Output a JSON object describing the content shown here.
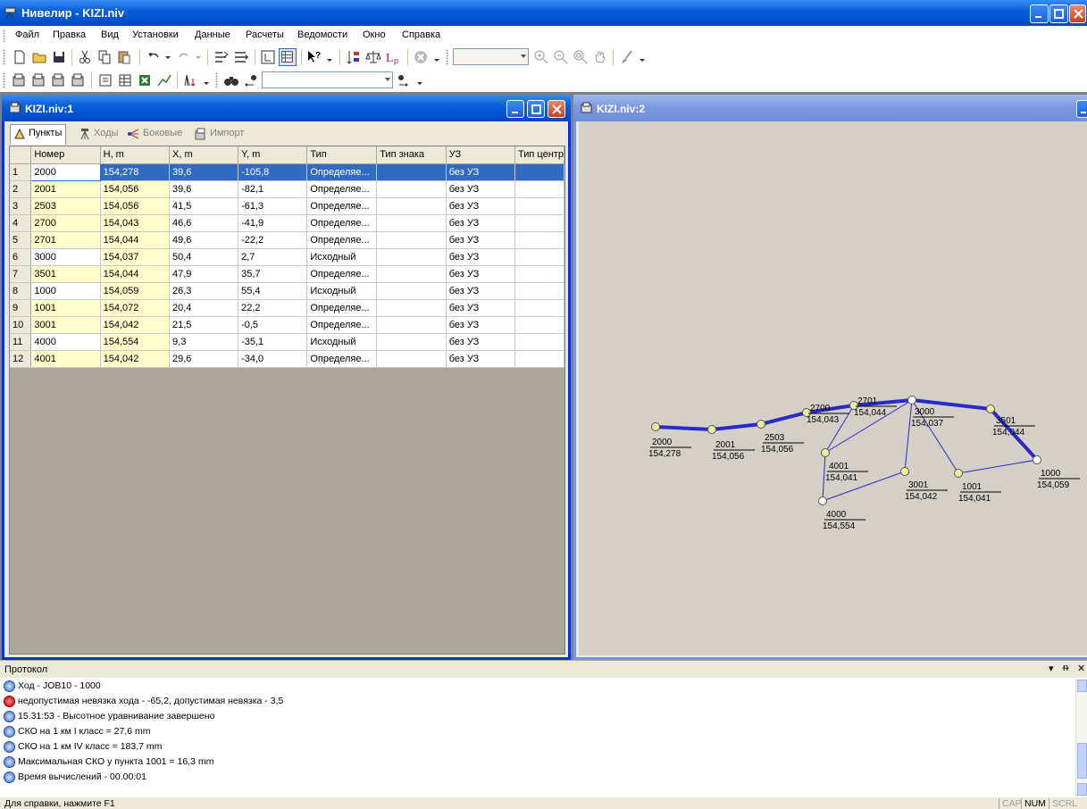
{
  "app": {
    "title": "Нивелир - KIZI.niv"
  },
  "menu": [
    "Файл",
    "Правка",
    "Вид",
    "Установки",
    "Данные",
    "Расчеты",
    "Ведомости",
    "Окно",
    "Справка"
  ],
  "windows": {
    "table_title": "KIZI.niv:1",
    "map_title": "KIZI.niv:2"
  },
  "tabs": [
    {
      "label": "Пункты",
      "active": true,
      "icon": "survey-point-icon"
    },
    {
      "label": "Ходы",
      "active": false,
      "icon": "tripod-icon"
    },
    {
      "label": "Боковые",
      "active": false,
      "icon": "branch-icon"
    },
    {
      "label": "Импорт",
      "active": false,
      "icon": "import-icon"
    }
  ],
  "table": {
    "columns": [
      "Номер",
      "H, m",
      "X, m",
      "Y, m",
      "Тип",
      "Тип знака",
      "УЗ",
      "Тип центр"
    ],
    "rows": [
      {
        "n": "1",
        "num": "2000",
        "h": "154,278",
        "x": "39,6",
        "y": "-105,8",
        "type": "Определяе...",
        "sign": "",
        "uz": "без УЗ",
        "center": ""
      },
      {
        "n": "2",
        "num": "2001",
        "h": "154,056",
        "x": "39,6",
        "y": "-82,1",
        "type": "Определяе...",
        "sign": "",
        "uz": "без УЗ",
        "center": ""
      },
      {
        "n": "3",
        "num": "2503",
        "h": "154,056",
        "x": "41,5",
        "y": "-61,3",
        "type": "Определяе...",
        "sign": "",
        "uz": "без УЗ",
        "center": ""
      },
      {
        "n": "4",
        "num": "2700",
        "h": "154,043",
        "x": "46,6",
        "y": "-41,9",
        "type": "Определяе...",
        "sign": "",
        "uz": "без УЗ",
        "center": ""
      },
      {
        "n": "5",
        "num": "2701",
        "h": "154,044",
        "x": "49,6",
        "y": "-22,2",
        "type": "Определяе...",
        "sign": "",
        "uz": "без УЗ",
        "center": ""
      },
      {
        "n": "6",
        "num": "3000",
        "h": "154,037",
        "x": "50,4",
        "y": "2,7",
        "type": "Исходный",
        "sign": "",
        "uz": "без УЗ",
        "center": ""
      },
      {
        "n": "7",
        "num": "3501",
        "h": "154,044",
        "x": "47,9",
        "y": "35,7",
        "type": "Определяе...",
        "sign": "",
        "uz": "без УЗ",
        "center": ""
      },
      {
        "n": "8",
        "num": "1000",
        "h": "154,059",
        "x": "26,3",
        "y": "55,4",
        "type": "Исходный",
        "sign": "",
        "uz": "без УЗ",
        "center": ""
      },
      {
        "n": "9",
        "num": "1001",
        "h": "154,072",
        "x": "20,4",
        "y": "22,2",
        "type": "Определяе...",
        "sign": "",
        "uz": "без УЗ",
        "center": ""
      },
      {
        "n": "10",
        "num": "3001",
        "h": "154,042",
        "x": "21,5",
        "y": "-0,5",
        "type": "Определяе...",
        "sign": "",
        "uz": "без УЗ",
        "center": ""
      },
      {
        "n": "11",
        "num": "4000",
        "h": "154,554",
        "x": "9,3",
        "y": "-35,1",
        "type": "Исходный",
        "sign": "",
        "uz": "без УЗ",
        "center": ""
      },
      {
        "n": "12",
        "num": "4001",
        "h": "154,042",
        "x": "29,6",
        "y": "-34,0",
        "type": "Определяе...",
        "sign": "",
        "uz": "без УЗ",
        "center": ""
      }
    ]
  },
  "map_points": [
    {
      "name": "2000",
      "h": "154,278",
      "kind": "defined"
    },
    {
      "name": "2001",
      "h": "154,056",
      "kind": "defined"
    },
    {
      "name": "2503",
      "h": "154,056",
      "kind": "defined"
    },
    {
      "name": "2700",
      "h": "154,043",
      "kind": "defined"
    },
    {
      "name": "2701",
      "h": "154,044",
      "kind": "defined"
    },
    {
      "name": "3000",
      "h": "154,037",
      "kind": "base"
    },
    {
      "name": "3501",
      "h": "154,044",
      "kind": "defined"
    },
    {
      "name": "1000",
      "h": "154,059",
      "kind": "base"
    },
    {
      "name": "1001",
      "h": "154,041",
      "kind": "defined"
    },
    {
      "name": "3001",
      "h": "154,042",
      "kind": "defined"
    },
    {
      "name": "4000",
      "h": "154,554",
      "kind": "base"
    },
    {
      "name": "4001",
      "h": "154,041",
      "kind": "defined"
    }
  ],
  "protocol": {
    "title": "Протокол",
    "lines": [
      {
        "kind": "info",
        "text": "Ход - JOB10 - 1000"
      },
      {
        "kind": "error",
        "text": "недопустимая невязка хода - -65,2, допустимая невязка - 3,5"
      },
      {
        "kind": "info",
        "text": "15.31:53 - Высотное уравнивание завершено"
      },
      {
        "kind": "info",
        "text": "СКО на 1 км I класс = 27,6 mm"
      },
      {
        "kind": "info",
        "text": "СКО на 1 км IV класс = 183,7 mm"
      },
      {
        "kind": "info",
        "text": "Максимальная СКО у пункта 1001 = 16,3 mm"
      },
      {
        "kind": "info",
        "text": "Время вычислений - 00.00:01"
      }
    ]
  },
  "status": {
    "hint": "Для справки, нажмите F1",
    "cap": "CAP",
    "num": "NUM",
    "scrl": "SCRL"
  },
  "colors": {
    "selection": "#316ac5",
    "edit_column": "#ffffcc",
    "route_line": "#2a2ac8",
    "point_fill": "#f0f09a"
  }
}
